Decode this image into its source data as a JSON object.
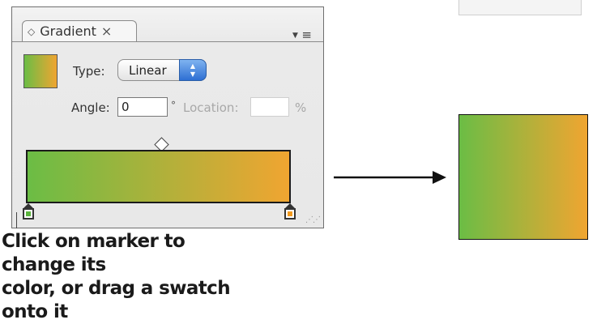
{
  "panel": {
    "tab_title": "Gradient",
    "tab_chevron": "◇",
    "tab_close": "×",
    "type_label": "Type:",
    "type_value": "Linear",
    "angle_label": "Angle:",
    "angle_value": "0",
    "degree_symbol": "°",
    "location_label": "Location:",
    "location_value": "",
    "percent_symbol": "%",
    "gradient_start_color": "#6bbd45",
    "gradient_end_color": "#f0a531",
    "stop_left_color": "#5ab43c",
    "stop_right_color": "#f39a1e"
  },
  "caption": {
    "line1": "Click on marker to change its",
    "line2": "color, or drag a swatch onto it"
  },
  "icons": {
    "menu": "panel-menu-icon",
    "arrow": "right-arrow-icon",
    "midpoint": "diamond-midpoint-icon",
    "grip": "resize-grip-icon"
  }
}
